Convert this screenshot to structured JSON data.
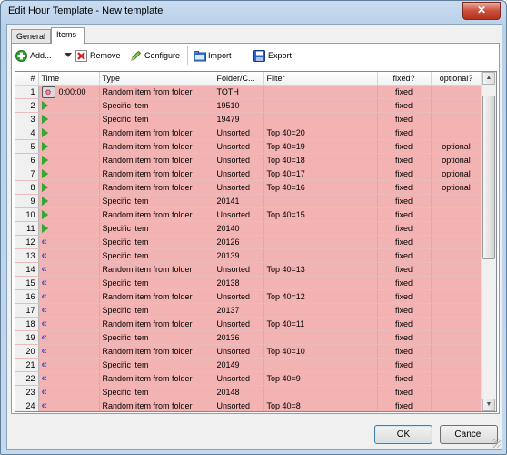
{
  "window": {
    "title": "Edit Hour Template - New template",
    "close_label": "✕"
  },
  "tabs": [
    {
      "label": "General",
      "active": false
    },
    {
      "label": "Items",
      "active": true
    }
  ],
  "toolbar": {
    "add_label": "Add...",
    "remove_label": "Remove",
    "configure_label": "Configure",
    "import_label": "Import",
    "export_label": "Export"
  },
  "columns": {
    "num": "#",
    "time": "Time",
    "type": "Type",
    "folder": "Folder/C...",
    "filter": "Filter",
    "fixed": "fixed?",
    "optional": "optional?"
  },
  "rows": [
    {
      "num": "1",
      "icon": "gear-icon",
      "time": "0:00:00",
      "type": "Random item from folder",
      "folder": "TOTH",
      "filter": "",
      "fixed": "fixed",
      "optional": ""
    },
    {
      "num": "2",
      "icon": "play-icon",
      "time": "",
      "type": "Specific item",
      "folder": "19510",
      "filter": "",
      "fixed": "fixed",
      "optional": ""
    },
    {
      "num": "3",
      "icon": "play-icon",
      "time": "",
      "type": "Specific item",
      "folder": "19479",
      "filter": "",
      "fixed": "fixed",
      "optional": ""
    },
    {
      "num": "4",
      "icon": "play-icon",
      "time": "",
      "type": "Random item from folder",
      "folder": "Unsorted",
      "filter": "Top 40=20",
      "fixed": "fixed",
      "optional": ""
    },
    {
      "num": "5",
      "icon": "play-icon",
      "time": "",
      "type": "Random item from folder",
      "folder": "Unsorted",
      "filter": "Top 40=19",
      "fixed": "fixed",
      "optional": "optional"
    },
    {
      "num": "6",
      "icon": "play-icon",
      "time": "",
      "type": "Random item from folder",
      "folder": "Unsorted",
      "filter": "Top 40=18",
      "fixed": "fixed",
      "optional": "optional"
    },
    {
      "num": "7",
      "icon": "play-icon",
      "time": "",
      "type": "Random item from folder",
      "folder": "Unsorted",
      "filter": "Top 40=17",
      "fixed": "fixed",
      "optional": "optional"
    },
    {
      "num": "8",
      "icon": "play-icon",
      "time": "",
      "type": "Random item from folder",
      "folder": "Unsorted",
      "filter": "Top 40=16",
      "fixed": "fixed",
      "optional": "optional"
    },
    {
      "num": "9",
      "icon": "play-icon",
      "time": "",
      "type": "Specific item",
      "folder": "20141",
      "filter": "",
      "fixed": "fixed",
      "optional": ""
    },
    {
      "num": "10",
      "icon": "play-icon",
      "time": "",
      "type": "Random item from folder",
      "folder": "Unsorted",
      "filter": "Top 40=15",
      "fixed": "fixed",
      "optional": ""
    },
    {
      "num": "11",
      "icon": "play-icon",
      "time": "",
      "type": "Specific item",
      "folder": "20140",
      "filter": "",
      "fixed": "fixed",
      "optional": ""
    },
    {
      "num": "12",
      "icon": "rewind-icon",
      "time": "",
      "type": "Specific item",
      "folder": "20126",
      "filter": "",
      "fixed": "fixed",
      "optional": ""
    },
    {
      "num": "13",
      "icon": "rewind-icon",
      "time": "",
      "type": "Specific item",
      "folder": "20139",
      "filter": "",
      "fixed": "fixed",
      "optional": ""
    },
    {
      "num": "14",
      "icon": "rewind-icon",
      "time": "",
      "type": "Random item from folder",
      "folder": "Unsorted",
      "filter": "Top 40=13",
      "fixed": "fixed",
      "optional": ""
    },
    {
      "num": "15",
      "icon": "rewind-icon",
      "time": "",
      "type": "Specific item",
      "folder": "20138",
      "filter": "",
      "fixed": "fixed",
      "optional": ""
    },
    {
      "num": "16",
      "icon": "rewind-icon",
      "time": "",
      "type": "Random item from folder",
      "folder": "Unsorted",
      "filter": "Top 40=12",
      "fixed": "fixed",
      "optional": ""
    },
    {
      "num": "17",
      "icon": "rewind-icon",
      "time": "",
      "type": "Specific item",
      "folder": "20137",
      "filter": "",
      "fixed": "fixed",
      "optional": ""
    },
    {
      "num": "18",
      "icon": "rewind-icon",
      "time": "",
      "type": "Random item from folder",
      "folder": "Unsorted",
      "filter": "Top 40=11",
      "fixed": "fixed",
      "optional": ""
    },
    {
      "num": "19",
      "icon": "rewind-icon",
      "time": "",
      "type": "Specific item",
      "folder": "20136",
      "filter": "",
      "fixed": "fixed",
      "optional": ""
    },
    {
      "num": "20",
      "icon": "rewind-icon",
      "time": "",
      "type": "Random item from folder",
      "folder": "Unsorted",
      "filter": "Top 40=10",
      "fixed": "fixed",
      "optional": ""
    },
    {
      "num": "21",
      "icon": "rewind-icon",
      "time": "",
      "type": "Specific item",
      "folder": "20149",
      "filter": "",
      "fixed": "fixed",
      "optional": ""
    },
    {
      "num": "22",
      "icon": "rewind-icon",
      "time": "",
      "type": "Random item from folder",
      "folder": "Unsorted",
      "filter": "Top 40=9",
      "fixed": "fixed",
      "optional": ""
    },
    {
      "num": "23",
      "icon": "rewind-icon",
      "time": "",
      "type": "Specific item",
      "folder": "20148",
      "filter": "",
      "fixed": "fixed",
      "optional": ""
    },
    {
      "num": "24",
      "icon": "rewind-icon",
      "time": "",
      "type": "Random item from folder",
      "folder": "Unsorted",
      "filter": "Top 40=8",
      "fixed": "fixed",
      "optional": ""
    }
  ],
  "buttons": {
    "ok_label": "OK",
    "cancel_label": "Cancel"
  },
  "colors": {
    "row_bg": "#f4b3b3",
    "play_icon": "#33a833",
    "rewind_icon": "#2b4fd4"
  }
}
